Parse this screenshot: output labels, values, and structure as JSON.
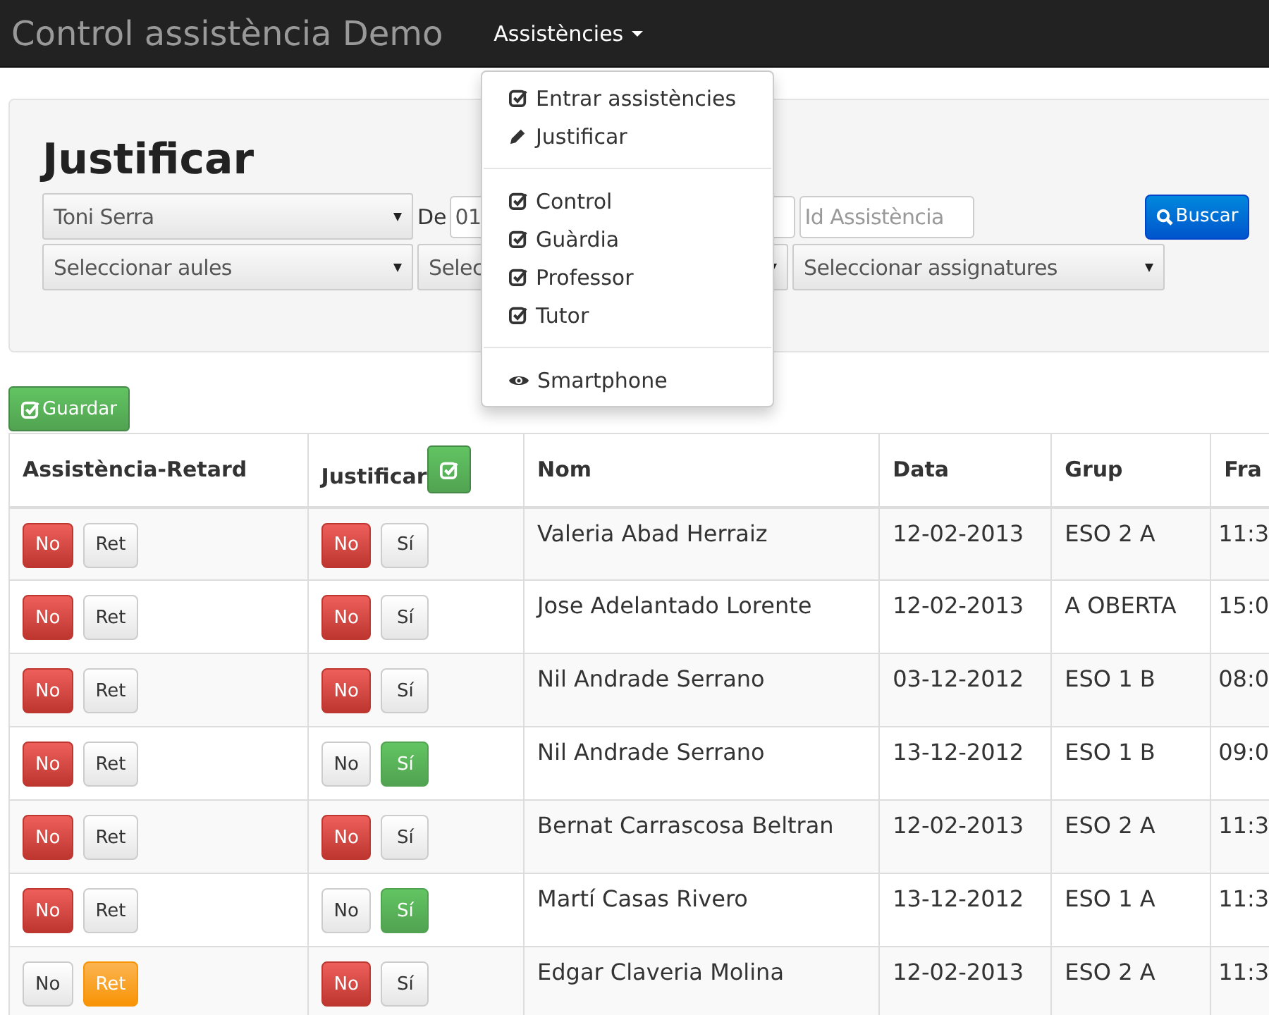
{
  "navbar": {
    "brand": "Control assistència Demo",
    "menu": {
      "label": "Assistències",
      "expanded": true
    }
  },
  "dropdown": [
    {
      "kind": "check",
      "label": "Entrar assistències"
    },
    {
      "kind": "pencil",
      "label": "Justificar"
    },
    {
      "kind": "divider"
    },
    {
      "kind": "check",
      "label": "Control"
    },
    {
      "kind": "check",
      "label": "Guàrdia"
    },
    {
      "kind": "check",
      "label": "Professor"
    },
    {
      "kind": "check",
      "label": "Tutor"
    },
    {
      "kind": "divider"
    },
    {
      "kind": "eye",
      "label": "Smartphone"
    }
  ],
  "form": {
    "title": "Justificar",
    "teacher_select": "Toni Serra",
    "from_label": "De",
    "from_value": "01",
    "id_placeholder": "Id Assistència",
    "search_button": "Buscar",
    "rooms_select": "Seleccionar aules",
    "select_2": "Selec",
    "subjects_select": "Seleccionar assignatures"
  },
  "save_button": "Guardar",
  "table": {
    "columns": [
      "Assistència-Retard",
      "Justificar",
      "Nom",
      "Data",
      "Grup",
      "Fra"
    ],
    "rows": [
      {
        "attendance": [
          {
            "kind": "absent",
            "label": "No",
            "selected": true
          },
          {
            "kind": "late",
            "label": "Ret",
            "selected": false
          }
        ],
        "justify": [
          {
            "kind": "absent",
            "label": "No",
            "selected": true
          },
          {
            "kind": "yes",
            "label": "Sí",
            "selected": false
          }
        ],
        "name": "Valeria Abad Herraiz",
        "date": "12-02-2013",
        "group": "ESO 2 A",
        "column_6": "11:3"
      },
      {
        "attendance": [
          {
            "kind": "absent",
            "label": "No",
            "selected": true
          },
          {
            "kind": "late",
            "label": "Ret",
            "selected": false
          }
        ],
        "justify": [
          {
            "kind": "absent",
            "label": "No",
            "selected": true
          },
          {
            "kind": "yes",
            "label": "Sí",
            "selected": false
          }
        ],
        "name": "Jose Adelantado Lorente",
        "date": "12-02-2013",
        "group": "A OBERTA",
        "column_6": "15:0"
      },
      {
        "attendance": [
          {
            "kind": "absent",
            "label": "No",
            "selected": true
          },
          {
            "kind": "late",
            "label": "Ret",
            "selected": false
          }
        ],
        "justify": [
          {
            "kind": "absent",
            "label": "No",
            "selected": true
          },
          {
            "kind": "yes",
            "label": "Sí",
            "selected": false
          }
        ],
        "name": "Nil Andrade Serrano",
        "date": "03-12-2012",
        "group": "ESO 1 B",
        "column_6": "08:0"
      },
      {
        "attendance": [
          {
            "kind": "absent",
            "label": "No",
            "selected": true
          },
          {
            "kind": "late",
            "label": "Ret",
            "selected": false
          }
        ],
        "justify": [
          {
            "kind": "absent",
            "label": "No",
            "selected": false
          },
          {
            "kind": "yes",
            "label": "Sí",
            "selected": true
          }
        ],
        "name": "Nil Andrade Serrano",
        "date": "13-12-2012",
        "group": "ESO 1 B",
        "column_6": "09:0"
      },
      {
        "attendance": [
          {
            "kind": "absent",
            "label": "No",
            "selected": true
          },
          {
            "kind": "late",
            "label": "Ret",
            "selected": false
          }
        ],
        "justify": [
          {
            "kind": "absent",
            "label": "No",
            "selected": true
          },
          {
            "kind": "yes",
            "label": "Sí",
            "selected": false
          }
        ],
        "name": "Bernat Carrascosa Beltran",
        "date": "12-02-2013",
        "group": "ESO 2 A",
        "column_6": "11:3"
      },
      {
        "attendance": [
          {
            "kind": "absent",
            "label": "No",
            "selected": true
          },
          {
            "kind": "late",
            "label": "Ret",
            "selected": false
          }
        ],
        "justify": [
          {
            "kind": "absent",
            "label": "No",
            "selected": false
          },
          {
            "kind": "yes",
            "label": "Sí",
            "selected": true
          }
        ],
        "name": "Martí Casas Rivero",
        "date": "13-12-2012",
        "group": "ESO 1 A",
        "column_6": "11:3"
      },
      {
        "attendance": [
          {
            "kind": "absent",
            "label": "No",
            "selected": false
          },
          {
            "kind": "late",
            "label": "Ret",
            "selected": true
          }
        ],
        "justify": [
          {
            "kind": "absent",
            "label": "No",
            "selected": true
          },
          {
            "kind": "yes",
            "label": "Sí",
            "selected": false
          }
        ],
        "name": "Edgar Claveria Molina",
        "date": "12-02-2013",
        "group": "ESO 2 A",
        "column_6": "11:3"
      }
    ]
  }
}
